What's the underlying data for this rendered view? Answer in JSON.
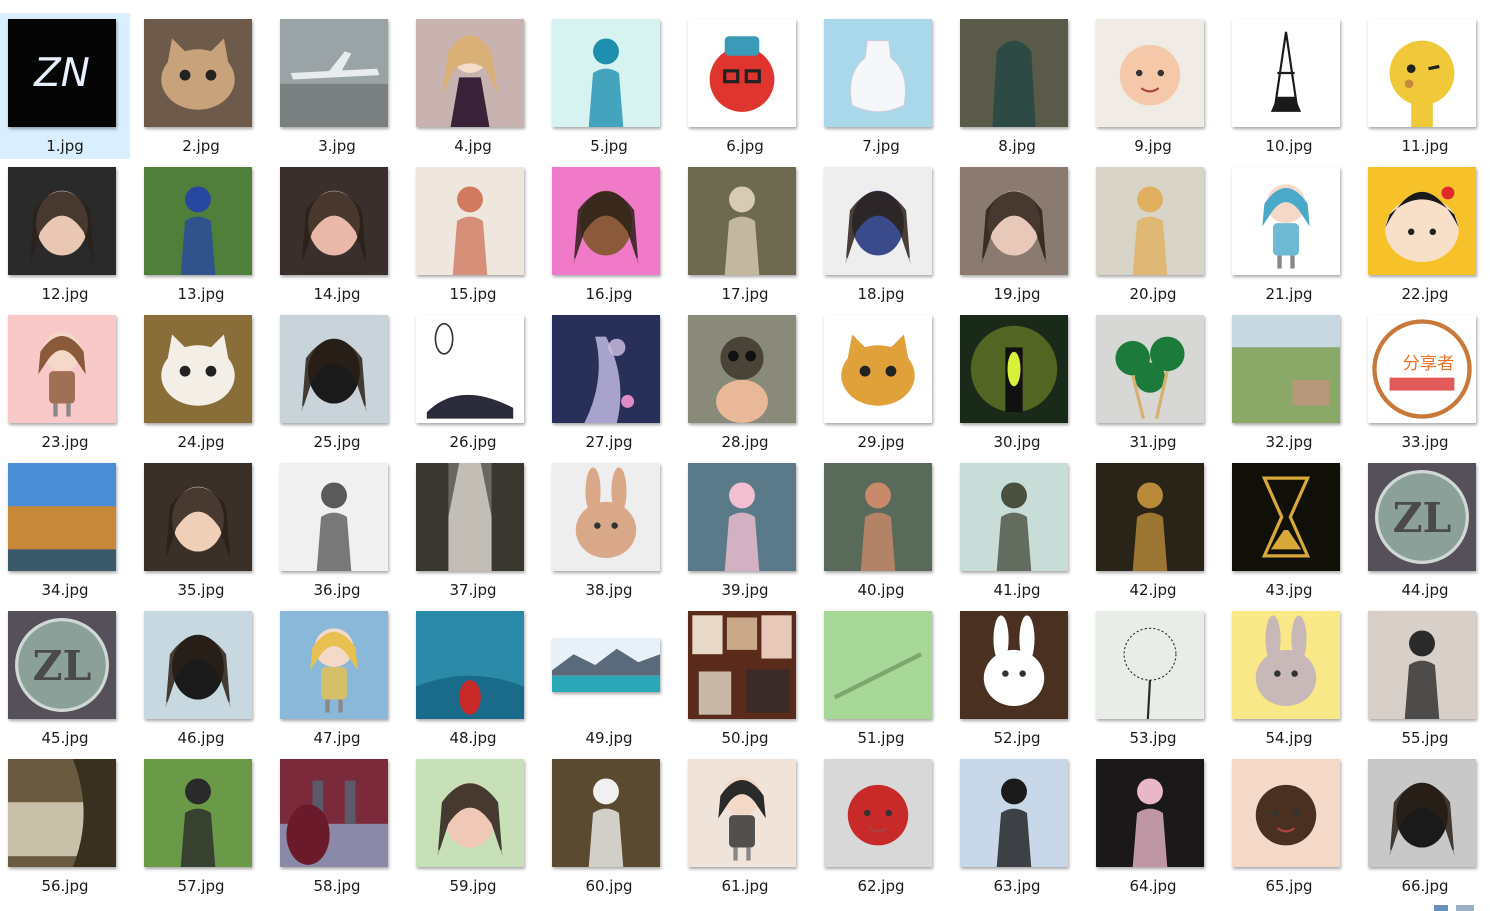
{
  "files": [
    {
      "name": "1.jpg",
      "bg": "#050505",
      "accent": "#e8f0ff",
      "motif": "text",
      "text": "ZN",
      "selected": true
    },
    {
      "name": "2.jpg",
      "bg": "#6e5a4a",
      "accent": "#c8a27a",
      "motif": "cat"
    },
    {
      "name": "3.jpg",
      "bg": "#9aa3a6",
      "accent": "#e9ecec",
      "motif": "plane"
    },
    {
      "name": "4.jpg",
      "bg": "#c9b3b0",
      "accent": "#3a2238",
      "motif": "doll"
    },
    {
      "name": "5.jpg",
      "bg": "#d7f3f1",
      "accent": "#1f8fb0",
      "motif": "person"
    },
    {
      "name": "6.jpg",
      "bg": "#ffffff",
      "accent": "#e0342e",
      "motif": "fox"
    },
    {
      "name": "7.jpg",
      "bg": "#a9d8ea",
      "accent": "#f5f7fa",
      "motif": "bottle"
    },
    {
      "name": "8.jpg",
      "bg": "#5a5a4a",
      "accent": "#2e4a44",
      "motif": "statue"
    },
    {
      "name": "9.jpg",
      "bg": "#f1ebe5",
      "accent": "#f4c8a8",
      "motif": "baby"
    },
    {
      "name": "10.jpg",
      "bg": "#ffffff",
      "accent": "#1a1a1a",
      "motif": "tower"
    },
    {
      "name": "11.jpg",
      "bg": "#ffffff",
      "accent": "#f0c93a",
      "motif": "giraffe"
    },
    {
      "name": "12.jpg",
      "bg": "#2a2a2a",
      "accent": "#e9c7b2",
      "motif": "face"
    },
    {
      "name": "13.jpg",
      "bg": "#4f7f3a",
      "accent": "#2848a0",
      "motif": "person"
    },
    {
      "name": "14.jpg",
      "bg": "#3a2f2c",
      "accent": "#e9b8a8",
      "motif": "face"
    },
    {
      "name": "15.jpg",
      "bg": "#efe7de",
      "accent": "#d07a60",
      "motif": "person"
    },
    {
      "name": "16.jpg",
      "bg": "#f17ac8",
      "accent": "#8b5a3a",
      "motif": "face"
    },
    {
      "name": "17.jpg",
      "bg": "#6e6a52",
      "accent": "#d8cbb4",
      "motif": "person"
    },
    {
      "name": "18.jpg",
      "bg": "#eeeeee",
      "accent": "#3a4a8a",
      "motif": "face"
    },
    {
      "name": "19.jpg",
      "bg": "#8a7a70",
      "accent": "#e8c8b8",
      "motif": "face"
    },
    {
      "name": "20.jpg",
      "bg": "#d9d4c8",
      "accent": "#e0b060",
      "motif": "person"
    },
    {
      "name": "21.jpg",
      "bg": "#ffffff",
      "accent": "#4aa8c8",
      "motif": "girl"
    },
    {
      "name": "22.jpg",
      "bg": "#f7c12a",
      "accent": "#1a1a1a",
      "motif": "cartoon"
    },
    {
      "name": "23.jpg",
      "bg": "#f9c8c8",
      "accent": "#8a5a3a",
      "motif": "girl"
    },
    {
      "name": "24.jpg",
      "bg": "#8a6e3a",
      "accent": "#f4efe6",
      "motif": "cat"
    },
    {
      "name": "25.jpg",
      "bg": "#c9d3da",
      "accent": "#1a1a1a",
      "motif": "face"
    },
    {
      "name": "26.jpg",
      "bg": "#ffffff",
      "accent": "#2a2a3a",
      "motif": "sketch"
    },
    {
      "name": "27.jpg",
      "bg": "#28305a",
      "accent": "#c8c0e8",
      "motif": "space"
    },
    {
      "name": "28.jpg",
      "bg": "#8a8a7a",
      "accent": "#4a4438",
      "motif": "monkey"
    },
    {
      "name": "29.jpg",
      "bg": "#ffffff",
      "accent": "#e0a03a",
      "motif": "cat"
    },
    {
      "name": "30.jpg",
      "bg": "#1a2a18",
      "accent": "#d8f03a",
      "motif": "lamp"
    },
    {
      "name": "31.jpg",
      "bg": "#d7d8d5",
      "accent": "#1c7a3a",
      "motif": "lollipop"
    },
    {
      "name": "32.jpg",
      "bg": "#3a5a30",
      "accent": "#8aa868",
      "motif": "landscape"
    },
    {
      "name": "33.jpg",
      "bg": "#ffffff",
      "accent": "#c8783a",
      "motif": "badge",
      "text": "分享者"
    },
    {
      "name": "34.jpg",
      "bg": "#3a7ec8",
      "accent": "#c8883a",
      "motif": "city"
    },
    {
      "name": "35.jpg",
      "bg": "#3a3028",
      "accent": "#f0cfb8",
      "motif": "face"
    },
    {
      "name": "36.jpg",
      "bg": "#f0f0f0",
      "accent": "#5a5a5a",
      "motif": "person"
    },
    {
      "name": "37.jpg",
      "bg": "#6a6660",
      "accent": "#e8e4dc",
      "motif": "street"
    },
    {
      "name": "38.jpg",
      "bg": "#eeeeee",
      "accent": "#d8a888",
      "motif": "rabbit"
    },
    {
      "name": "39.jpg",
      "bg": "#5a7a8a",
      "accent": "#f0c0d0",
      "motif": "person"
    },
    {
      "name": "40.jpg",
      "bg": "#5a6a5a",
      "accent": "#c88a6a",
      "motif": "person"
    },
    {
      "name": "41.jpg",
      "bg": "#c8dcd8",
      "accent": "#4a5040",
      "motif": "person"
    },
    {
      "name": "42.jpg",
      "bg": "#2a2418",
      "accent": "#b88a3a",
      "motif": "person"
    },
    {
      "name": "43.jpg",
      "bg": "#101008",
      "accent": "#d8a83a",
      "motif": "hourglass"
    },
    {
      "name": "44.jpg",
      "bg": "#56505a",
      "accent": "#8aa098",
      "motif": "coin",
      "text": "ZL"
    },
    {
      "name": "45.jpg",
      "bg": "#56505a",
      "accent": "#8aa098",
      "motif": "coin",
      "text": "ZL"
    },
    {
      "name": "46.jpg",
      "bg": "#c8d8e0",
      "accent": "#1a1a1a",
      "motif": "face"
    },
    {
      "name": "47.jpg",
      "bg": "#8ab8d8",
      "accent": "#e8c050",
      "motif": "girl"
    },
    {
      "name": "48.jpg",
      "bg": "#1a6a8a",
      "accent": "#c82a2a",
      "motif": "aquarium"
    },
    {
      "name": "49.jpg",
      "bg": "#2aa8b8",
      "accent": "#ffffff",
      "motif": "mountain",
      "wide": true
    },
    {
      "name": "50.jpg",
      "bg": "#5a2a1a",
      "accent": "#e8d8c8",
      "motif": "collage"
    },
    {
      "name": "51.jpg",
      "bg": "#a8d898",
      "accent": "#3a6a3a",
      "motif": "wall"
    },
    {
      "name": "52.jpg",
      "bg": "#4a3020",
      "accent": "#ffffff",
      "motif": "rabbit"
    },
    {
      "name": "53.jpg",
      "bg": "#e8ede8",
      "accent": "#2a2a2a",
      "motif": "dandelion"
    },
    {
      "name": "54.jpg",
      "bg": "#f8e888",
      "accent": "#c8b8b8",
      "motif": "rabbit"
    },
    {
      "name": "55.jpg",
      "bg": "#d8d0c8",
      "accent": "#2a2a2a",
      "motif": "person"
    },
    {
      "name": "56.jpg",
      "bg": "#6a5a40",
      "accent": "#c8c0a8",
      "motif": "building"
    },
    {
      "name": "57.jpg",
      "bg": "#6a9a48",
      "accent": "#2a2a2a",
      "motif": "person"
    },
    {
      "name": "58.jpg",
      "bg": "#7a2a3a",
      "accent": "#d8c8c8",
      "motif": "bridge"
    },
    {
      "name": "59.jpg",
      "bg": "#c8e0b8",
      "accent": "#f0c8b8",
      "motif": "face"
    },
    {
      "name": "60.jpg",
      "bg": "#5a4a30",
      "accent": "#f0f0f0",
      "motif": "person"
    },
    {
      "name": "61.jpg",
      "bg": "#f0e4da",
      "accent": "#2a2a2a",
      "motif": "girl"
    },
    {
      "name": "62.jpg",
      "bg": "#d8d8d8",
      "accent": "#c82a2a",
      "motif": "baby"
    },
    {
      "name": "63.jpg",
      "bg": "#c8d8e8",
      "accent": "#1a1a1a",
      "motif": "person"
    },
    {
      "name": "64.jpg",
      "bg": "#1a1818",
      "accent": "#e8b8c8",
      "motif": "person"
    },
    {
      "name": "65.jpg",
      "bg": "#f4d8c8",
      "accent": "#4a3020",
      "motif": "baby"
    },
    {
      "name": "66.jpg",
      "bg": "#c8c8c8",
      "accent": "#1a1a1a",
      "motif": "face"
    }
  ]
}
